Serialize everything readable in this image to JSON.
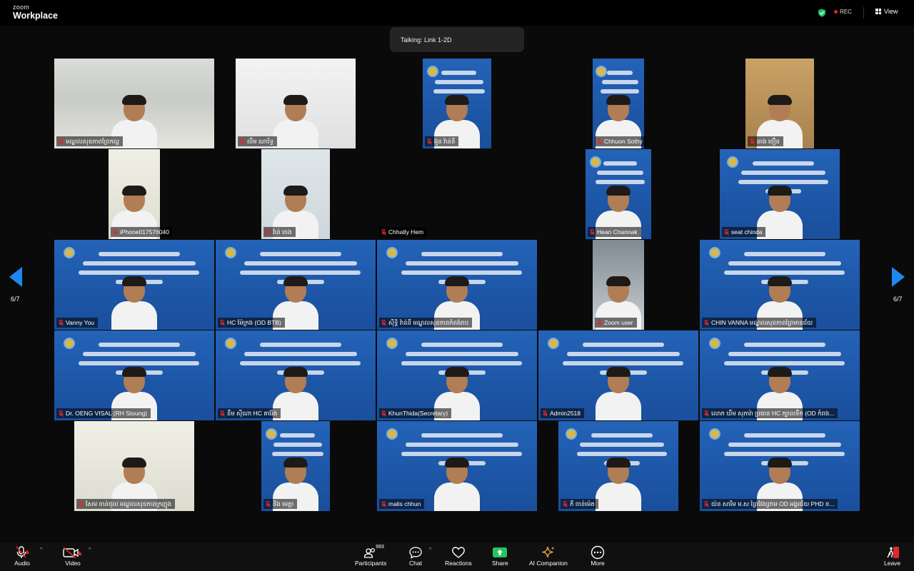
{
  "app": {
    "logo_top": "zoom",
    "logo_bottom": "Workplace"
  },
  "header": {
    "rec_label": "REC",
    "view_label": "View"
  },
  "talking": "Talking: Link 1-2D",
  "pagination": {
    "left": "6/7",
    "right": "6/7"
  },
  "tiles": [
    {
      "name": "មណ្ឌលសុខភាពព្រែកល្អ",
      "scene": "office"
    },
    {
      "name": "លឹម ណារិទ្ធ",
      "scene": "white"
    },
    {
      "name": "អ៊ួន វ៉ាន់នី",
      "scene": "banner"
    },
    {
      "name": "Chhuon Sothy",
      "scene": "banner"
    },
    {
      "name": "ឆាង ចឿន",
      "scene": "room"
    },
    {
      "name": "iPhone017576040",
      "scene": "clinic"
    },
    {
      "name": "វ៉ាន់ ចេង",
      "scene": "hall"
    },
    {
      "name": "Chhatly Hem",
      "scene": "none"
    },
    {
      "name": "Hean Channak",
      "scene": "banner"
    },
    {
      "name": "seat chinda",
      "scene": "banner"
    },
    {
      "name": "Vanny You",
      "scene": "banner"
    },
    {
      "name": "HC ម៉ែក្រង (OD BTB)",
      "scene": "banner"
    },
    {
      "name": "ស៊ីទ្ធិ វ៉ាន់នី មណ្ឌលសុខភាពកំពង់រាប",
      "scene": "banner"
    },
    {
      "name": "Zoom user",
      "scene": "door"
    },
    {
      "name": "CHIN VANNA មណ្ឌលសុខភាពព្រៃមានជ័យ",
      "scene": "banner"
    },
    {
      "name": "Dr. OENG VISAL (RH Stoung)",
      "scene": "banner"
    },
    {
      "name": "ខឹម ស៊ីណា HC គារ៉ែង",
      "scene": "banner"
    },
    {
      "name": "KhunThida(Secretary)",
      "scene": "banner"
    },
    {
      "name": "Admin2518",
      "scene": "banner"
    },
    {
      "name": "លោក ឃឹម សុភារ៉ា ប្រធាន HC ក្បាលទឹក (OD កំពង...",
      "scene": "banner"
    },
    {
      "name": "សែម ចាន់ថុល មណ្ឌលសុខភាពក្រញូង",
      "scene": "clinic"
    },
    {
      "name": "នីង មេត្តា",
      "scene": "banner"
    },
    {
      "name": "malis chhun",
      "scene": "banner"
    },
    {
      "name": "ភី ចាន់ម៉េត",
      "scene": "banner"
    },
    {
      "name": "យ៉ន សារិម ម.ស ព្រៃវែងព្រាម OD អង្គរជ័យ PHD ន...",
      "scene": "banner"
    }
  ],
  "toolbar": {
    "audio": "Audio",
    "video": "Video",
    "participants": "Participants",
    "participants_count": "993",
    "chat": "Chat",
    "reactions": "Reactions",
    "share": "Share",
    "ai_companion": "AI Companion",
    "more": "More",
    "leave": "Leave"
  },
  "colors": {
    "accent": "#1e88f0",
    "share_green": "#23c55e",
    "ai_gold": "#e8a33b",
    "mute_red": "#e0282e"
  }
}
